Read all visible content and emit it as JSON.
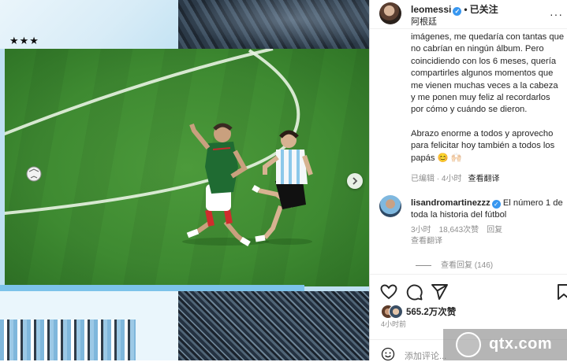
{
  "media": {
    "stars": "★★★"
  },
  "post": {
    "username": "leomessi",
    "follow_label": "已关注",
    "dot": "•",
    "location": "阿根廷",
    "more": "···",
    "caption": [
      "imágenes, me quedaría con tantas que no cabrían en ningún álbum. Pero coincidiendo con los 6 meses, quería compartirles algunos momentos que me vienen muchas veces a la cabeza y me ponen muy feliz al recordarlos por cómo y cuándo se dieron.",
      "Abrazo enorme a todos y aprovecho para felicitar hoy también a todos los papás 😊 🙌🏻"
    ],
    "meta_edited": "已编辑 · 4小时",
    "meta_translate": "查看翻译"
  },
  "comment": {
    "username": "lisandromartinezzz",
    "text": " El número 1 de toda la historia del fútbol",
    "time": "3小时",
    "likes": "18,643次赞",
    "reply": "回复",
    "translate": "查看翻译",
    "view_replies": "查看回复 (146)"
  },
  "actions": {
    "likes_count": "565.2万次赞",
    "time_ago": "4小时前",
    "add_comment_placeholder": "添加评论..."
  },
  "watermark": {
    "text": "qtx.com"
  }
}
